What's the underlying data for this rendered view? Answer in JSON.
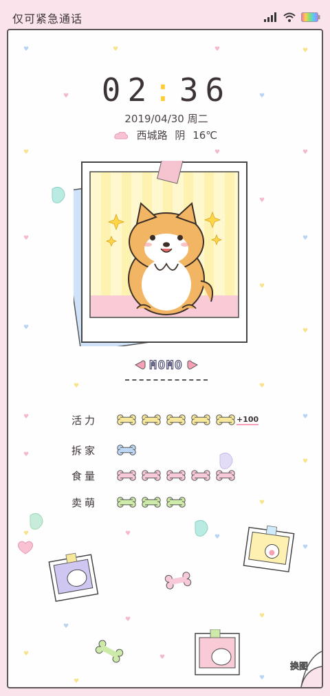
{
  "status_bar": {
    "carrier": "仅可紧急通话",
    "icons": [
      "signal-icon",
      "wifi-icon",
      "battery-icon"
    ]
  },
  "clock": {
    "hour": "02",
    "separator": ":",
    "minute": "36"
  },
  "date": "2019/04/30 周二",
  "weather": {
    "location": "西城路",
    "condition": "阴",
    "temperature": "16℃"
  },
  "pet": {
    "name": "MOMO"
  },
  "stats": [
    {
      "label": "活力",
      "bones": 5,
      "bone_color": "#f6e79a",
      "bonus": "+100"
    },
    {
      "label": "拆家",
      "bones": 1,
      "bone_color": "#bcd8f5",
      "bonus": ""
    },
    {
      "label": "食量",
      "bones": 5,
      "bone_color": "#f8c9d8",
      "bonus": ""
    },
    {
      "label": "卖萌",
      "bones": 3,
      "bone_color": "#cdeaa8",
      "bonus": ""
    }
  ],
  "theme_button": {
    "label": "换图"
  },
  "colors": {
    "background": "#fbe3ec",
    "card": "#fffefe",
    "accent": "#ffcc33",
    "dog_orange": "#f2b563"
  }
}
